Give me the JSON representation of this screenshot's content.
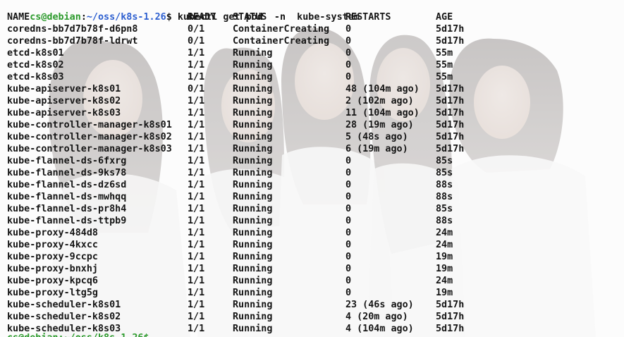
{
  "prompt": {
    "user_host": "cs@debian",
    "separator": ":",
    "path": "~/oss/k8s-1.26",
    "symbol": "$",
    "command": " kubectl get pod  -n  kube-system"
  },
  "table": {
    "headers": {
      "name": "NAME",
      "ready": "READY",
      "status": "STATUS",
      "restarts": "RESTARTS",
      "age": "AGE"
    },
    "rows": [
      {
        "name": "coredns-bb7d7b78f-d6pn8",
        "ready": "0/1",
        "status": "ContainerCreating",
        "restarts": "0",
        "age": "5d17h"
      },
      {
        "name": "coredns-bb7d7b78f-ldrwt",
        "ready": "0/1",
        "status": "ContainerCreating",
        "restarts": "0",
        "age": "5d17h"
      },
      {
        "name": "etcd-k8s01",
        "ready": "1/1",
        "status": "Running",
        "restarts": "0",
        "age": "55m"
      },
      {
        "name": "etcd-k8s02",
        "ready": "1/1",
        "status": "Running",
        "restarts": "0",
        "age": "55m"
      },
      {
        "name": "etcd-k8s03",
        "ready": "1/1",
        "status": "Running",
        "restarts": "0",
        "age": "55m"
      },
      {
        "name": "kube-apiserver-k8s01",
        "ready": "0/1",
        "status": "Running",
        "restarts": "48 (104m ago)",
        "age": "5d17h"
      },
      {
        "name": "kube-apiserver-k8s02",
        "ready": "1/1",
        "status": "Running",
        "restarts": "2 (102m ago)",
        "age": "5d17h"
      },
      {
        "name": "kube-apiserver-k8s03",
        "ready": "1/1",
        "status": "Running",
        "restarts": "11 (104m ago)",
        "age": "5d17h"
      },
      {
        "name": "kube-controller-manager-k8s01",
        "ready": "1/1",
        "status": "Running",
        "restarts": "28 (19m ago)",
        "age": "5d17h"
      },
      {
        "name": "kube-controller-manager-k8s02",
        "ready": "1/1",
        "status": "Running",
        "restarts": "5 (48s ago)",
        "age": "5d17h"
      },
      {
        "name": "kube-controller-manager-k8s03",
        "ready": "1/1",
        "status": "Running",
        "restarts": "6 (19m ago)",
        "age": "5d17h"
      },
      {
        "name": "kube-flannel-ds-6fxrg",
        "ready": "1/1",
        "status": "Running",
        "restarts": "0",
        "age": "85s"
      },
      {
        "name": "kube-flannel-ds-9ks78",
        "ready": "1/1",
        "status": "Running",
        "restarts": "0",
        "age": "85s"
      },
      {
        "name": "kube-flannel-ds-dz6sd",
        "ready": "1/1",
        "status": "Running",
        "restarts": "0",
        "age": "88s"
      },
      {
        "name": "kube-flannel-ds-mwhqq",
        "ready": "1/1",
        "status": "Running",
        "restarts": "0",
        "age": "88s"
      },
      {
        "name": "kube-flannel-ds-pr8h4",
        "ready": "1/1",
        "status": "Running",
        "restarts": "0",
        "age": "85s"
      },
      {
        "name": "kube-flannel-ds-ttpb9",
        "ready": "1/1",
        "status": "Running",
        "restarts": "0",
        "age": "88s"
      },
      {
        "name": "kube-proxy-484d8",
        "ready": "1/1",
        "status": "Running",
        "restarts": "0",
        "age": "24m"
      },
      {
        "name": "kube-proxy-4kxcc",
        "ready": "1/1",
        "status": "Running",
        "restarts": "0",
        "age": "24m"
      },
      {
        "name": "kube-proxy-9ccpc",
        "ready": "1/1",
        "status": "Running",
        "restarts": "0",
        "age": "19m"
      },
      {
        "name": "kube-proxy-bnxhj",
        "ready": "1/1",
        "status": "Running",
        "restarts": "0",
        "age": "19m"
      },
      {
        "name": "kube-proxy-kpcq6",
        "ready": "1/1",
        "status": "Running",
        "restarts": "0",
        "age": "24m"
      },
      {
        "name": "kube-proxy-ltg5g",
        "ready": "1/1",
        "status": "Running",
        "restarts": "0",
        "age": "19m"
      },
      {
        "name": "kube-scheduler-k8s01",
        "ready": "1/1",
        "status": "Running",
        "restarts": "23 (46s ago)",
        "age": "5d17h"
      },
      {
        "name": "kube-scheduler-k8s02",
        "ready": "1/1",
        "status": "Running",
        "restarts": "4 (20m ago)",
        "age": "5d17h"
      },
      {
        "name": "kube-scheduler-k8s03",
        "ready": "1/1",
        "status": "Running",
        "restarts": "4 (104m ago)",
        "age": "5d17h"
      }
    ]
  },
  "next_prompt_partial": "cs@debian:~/oss/k8s-1.26$",
  "colors": {
    "prompt_user": "#2c9a2c",
    "prompt_path": "#2d5fd0",
    "text": "#151515",
    "background": "#ffffff"
  }
}
